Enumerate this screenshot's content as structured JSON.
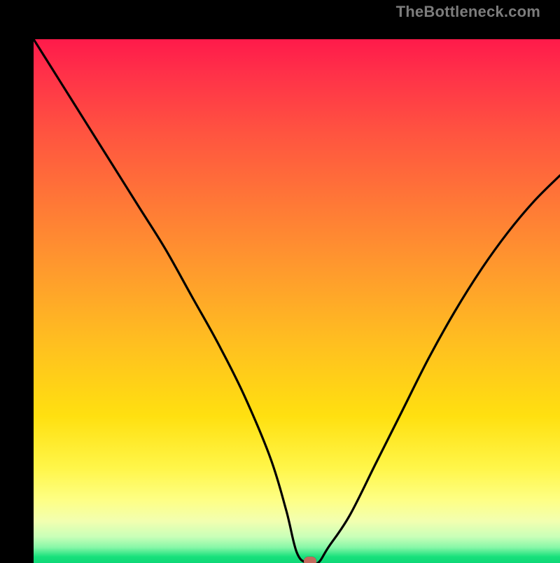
{
  "attribution": "TheBottleneck.com",
  "chart_data": {
    "type": "line",
    "title": "",
    "xlabel": "",
    "ylabel": "",
    "xlim": [
      0,
      100
    ],
    "ylim": [
      0,
      100
    ],
    "series": [
      {
        "name": "bottleneck-curve",
        "x": [
          0,
          5,
          10,
          15,
          20,
          25,
          30,
          35,
          40,
          45,
          48,
          50,
          52,
          54,
          56,
          60,
          65,
          70,
          75,
          80,
          85,
          90,
          95,
          100
        ],
        "y": [
          100,
          92,
          84,
          76,
          68,
          60,
          51,
          42,
          32,
          20,
          10,
          2,
          0,
          0,
          3,
          9,
          19,
          29,
          39,
          48,
          56,
          63,
          69,
          74
        ]
      }
    ],
    "marker": {
      "x": 52.5,
      "y": 0
    },
    "gradient_bands": [
      {
        "pos": 100,
        "color": "#ff1a4a"
      },
      {
        "pos": 50,
        "color": "#ffbf20"
      },
      {
        "pos": 10,
        "color": "#feff85"
      },
      {
        "pos": 0,
        "color": "#0fd877"
      }
    ]
  }
}
